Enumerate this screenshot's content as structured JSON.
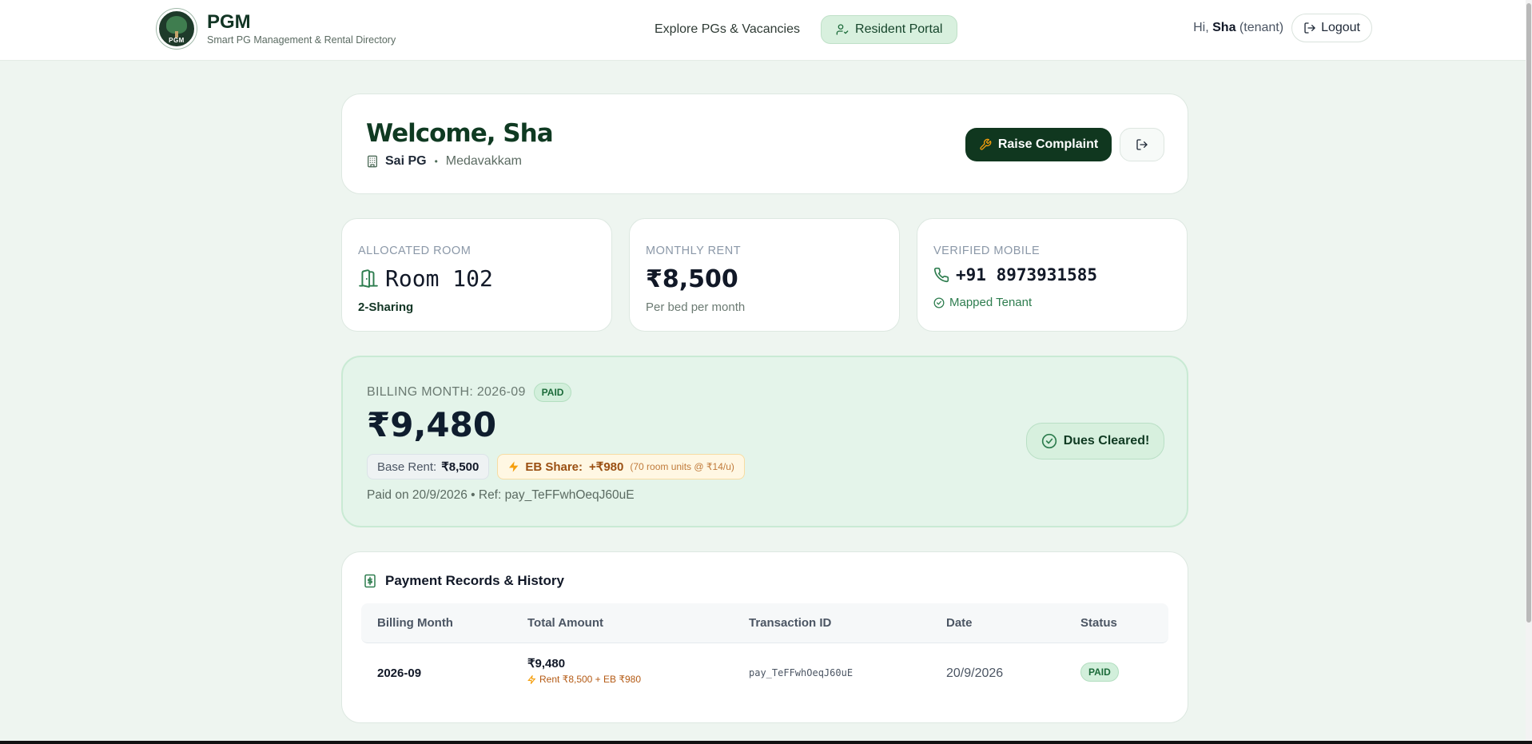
{
  "header": {
    "brand_name": "PGM",
    "brand_tagline": "Smart PG Management & Rental Directory",
    "logo_text": "PGM",
    "nav_explore": "Explore PGs & Vacancies",
    "nav_portal": "Resident Portal",
    "greeting_prefix": "Hi,",
    "user_name": "Sha",
    "user_role": "(tenant)",
    "logout_label": "Logout"
  },
  "welcome": {
    "title": "Welcome, Sha",
    "pg_name": "Sai PG",
    "separator": "•",
    "location": "Medavakkam",
    "raise_label": "Raise Complaint"
  },
  "stats": {
    "room": {
      "label": "ALLOCATED ROOM",
      "value": "Room 102",
      "sub": "2-Sharing"
    },
    "rent": {
      "label": "MONTHLY RENT",
      "value": "₹8,500",
      "sub": "Per bed per month"
    },
    "mobile": {
      "label": "VERIFIED MOBILE",
      "value": "+91 8973931585",
      "sub": "Mapped Tenant"
    }
  },
  "billing": {
    "month_label": "BILLING MONTH: 2026-09",
    "status": "PAID",
    "amount": "₹9,480",
    "base_label": "Base Rent:",
    "base_value": "₹8,500",
    "eb_label": "EB Share:",
    "eb_value": "+₹980",
    "eb_detail": "(70 room units @ ₹14/u)",
    "paid_line": "Paid on 20/9/2026 • Ref: pay_TeFFwhOeqJ60uE",
    "dues_label": "Dues Cleared!"
  },
  "history": {
    "title": "Payment Records & History",
    "columns": [
      "Billing Month",
      "Total Amount",
      "Transaction ID",
      "Date",
      "Status"
    ],
    "rows": [
      {
        "month": "2026-09",
        "total": "₹9,480",
        "breakdown": "Rent ₹8,500 + EB ₹980",
        "txn": "pay_TeFFwhOeqJ60uE",
        "date": "20/9/2026",
        "status": "PAID"
      }
    ]
  },
  "colors": {
    "primary": "#10371f",
    "accent_green": "#d8f0de",
    "billing_bg": "#e4f4ea",
    "eb_orange": "#9a4f12"
  }
}
